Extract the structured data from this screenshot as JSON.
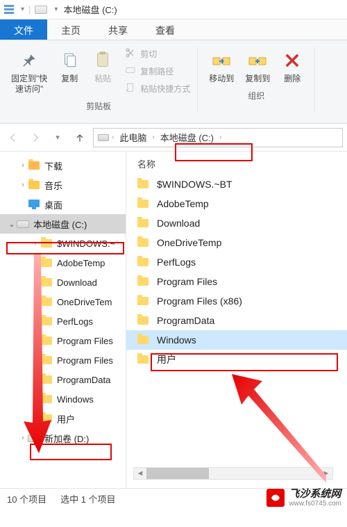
{
  "title": "本地磁盘 (C:)",
  "tabs": {
    "file": "文件",
    "home": "主页",
    "share": "共享",
    "view": "查看"
  },
  "ribbon": {
    "pin": "固定到\"快\n速访问\"",
    "copy": "复制",
    "paste": "粘贴",
    "cut": "剪切",
    "copypath": "复制路径",
    "pasteshortcut": "粘贴快捷方式",
    "group_clip": "剪贴板",
    "moveto": "移动到",
    "copyto": "复制到",
    "delete": "删除",
    "group_org": "组织"
  },
  "breadcrumbs": {
    "pc": "此电脑",
    "drive": "本地磁盘 (C:)"
  },
  "tree": {
    "downloads": "下载",
    "music": "音乐",
    "desktop": "桌面",
    "drivec": "本地磁盘 (C:)",
    "t_windowsbt": "$WINDOWS.~",
    "t_adobe": "AdobeTemp",
    "t_download": "Download",
    "t_onedrive": "OneDriveTem",
    "t_perflogs": "PerfLogs",
    "t_progfiles": "Program Files",
    "t_progfiles86": "Program Files",
    "t_progdata": "ProgramData",
    "t_windows": "Windows",
    "t_users": "用户",
    "drived": "新加卷 (D:)"
  },
  "files": {
    "header_name": "名称",
    "rows": [
      "$WINDOWS.~BT",
      "AdobeTemp",
      "Download",
      "OneDriveTemp",
      "PerfLogs",
      "Program Files",
      "Program Files (x86)",
      "ProgramData",
      "Windows",
      "用户"
    ],
    "selected_index": 8
  },
  "status": {
    "count": "10 个项目",
    "sel": "选中 1 个项目"
  },
  "watermark": {
    "name": "飞沙系统网",
    "url": "www.fs0745.com"
  }
}
